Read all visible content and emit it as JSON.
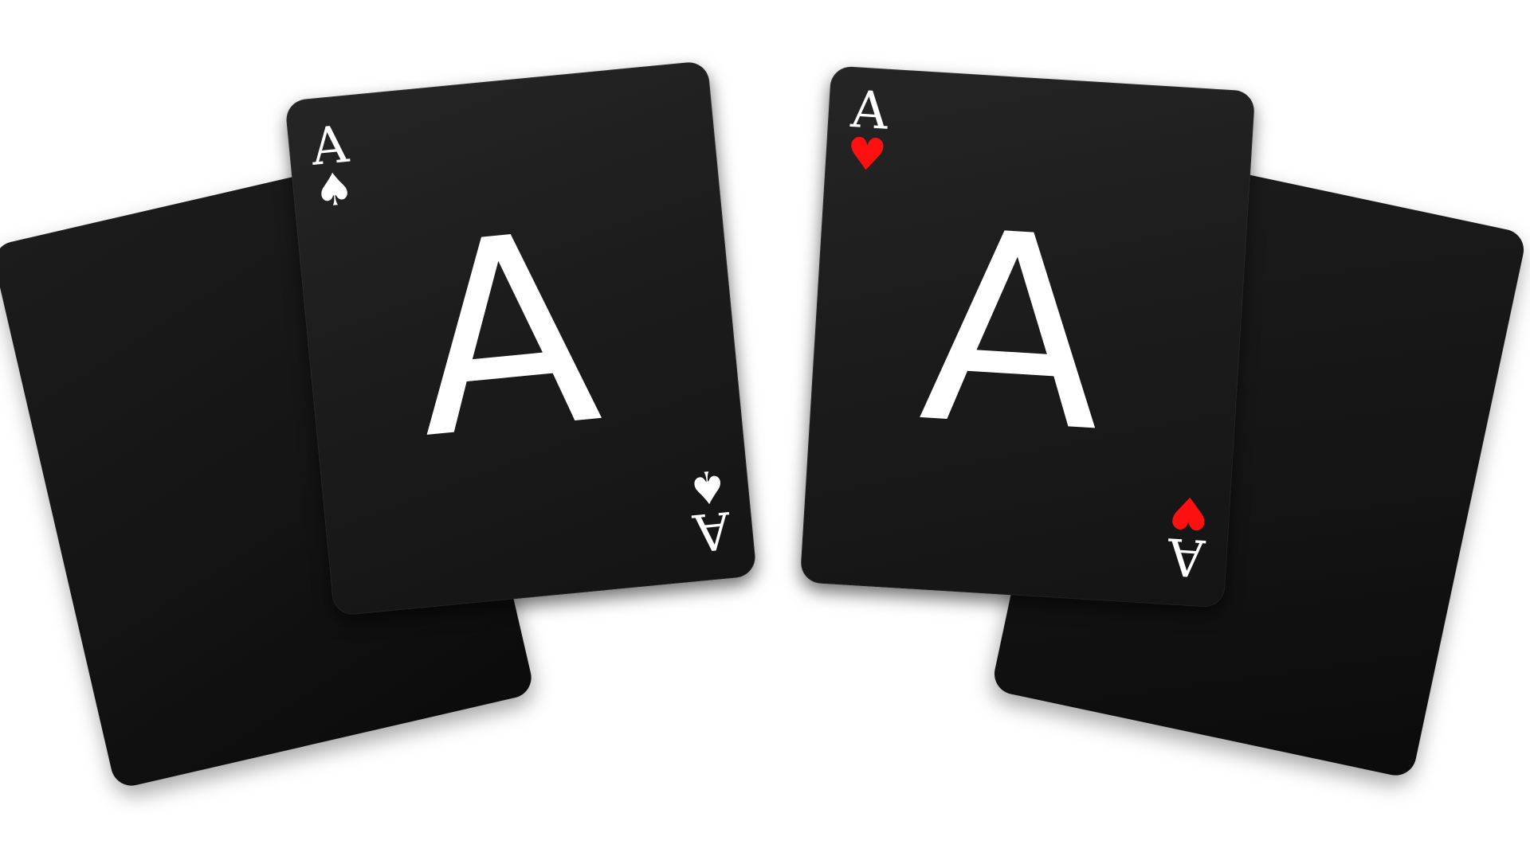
{
  "cards": [
    {
      "role": "back",
      "position": "left-back"
    },
    {
      "role": "face",
      "position": "left-front",
      "rank": "A",
      "suit_symbol": "♠",
      "suit_name": "spades-icon",
      "rank_color": "#ffffff",
      "suit_color": "#ffffff"
    },
    {
      "role": "back",
      "position": "right-back"
    },
    {
      "role": "face",
      "position": "right-front",
      "rank": "A",
      "suit_symbol": "♥",
      "suit_name": "hearts-icon",
      "rank_color": "#ffffff",
      "suit_color": "#ff1010"
    }
  ],
  "colors": {
    "background": "#ffffff",
    "card": "#1c1c1c",
    "hearts": "#ff1010",
    "spades": "#ffffff"
  }
}
